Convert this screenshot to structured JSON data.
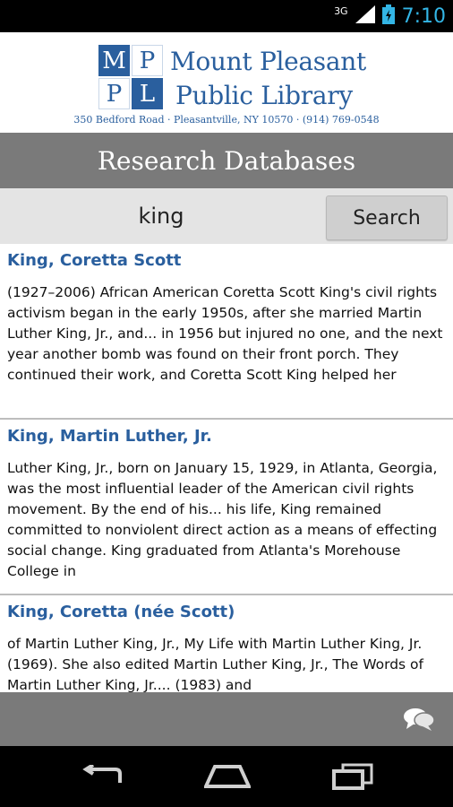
{
  "status_bar": {
    "network": "3G",
    "time": "7:10"
  },
  "header": {
    "logo_letters": [
      "M",
      "P",
      "P",
      "L"
    ],
    "library_name_line1": "Mount Pleasant",
    "library_name_line2": "Public Library",
    "address": "350 Bedford Road  ·  Pleasantville, NY 10570    ·    (914) 769-0548"
  },
  "page_title": "Research Databases",
  "search": {
    "value": "king",
    "button_label": "Search"
  },
  "results": [
    {
      "title": "King, Coretta Scott",
      "snippet": "(1927–2006) African American Coretta Scott King's civil rights activism began in the early 1950s, after she married Martin Luther King, Jr., and... in 1956 but injured no one, and the next year another bomb was found on their front porch. They continued their work, and Coretta Scott King helped her"
    },
    {
      "title": "King, Martin Luther, Jr.",
      "snippet": " Luther King, Jr., born on January 15, 1929, in Atlanta, Georgia, was the most influential leader of the American civil rights movement. By the end of his... his life, King remained committed to nonviolent direct action as a means of effecting social change. King graduated from Atlanta's Morehouse College in"
    },
    {
      "title": "King, Coretta (née Scott)",
      "snippet": " of Martin Luther King, Jr., My Life with Martin Luther King, Jr. (1969). She also edited Martin Luther King, Jr., The Words of Martin Luther King, Jr.... (1983) and"
    }
  ],
  "colors": {
    "brand_blue": "#2a5f9e",
    "bar_gray": "#7a7a7a",
    "status_accent": "#33b5e5"
  },
  "icons": {
    "status": [
      "signal-icon",
      "battery-icon"
    ],
    "bottom_bar": "chat-icon",
    "nav": [
      "back-icon",
      "home-icon",
      "recent-apps-icon"
    ]
  }
}
